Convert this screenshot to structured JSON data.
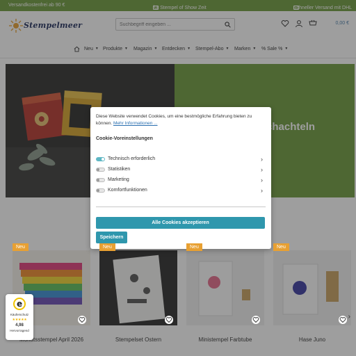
{
  "promo": {
    "left": "Versandkostenfrei ab 90 €",
    "center": "für Stempel of Show Zeit",
    "right": "Schneller Versand mit DHL"
  },
  "header": {
    "logo_text": "Stempelmeer",
    "search_placeholder": "Suchbegriff eingeben ...",
    "cart_value": "0,00 €",
    "icons": [
      "heart-icon",
      "user-icon",
      "cart-icon",
      "search-icon"
    ]
  },
  "nav": {
    "items": [
      {
        "label": "Neu"
      },
      {
        "label": "Produkte"
      },
      {
        "label": "Magazin"
      },
      {
        "label": "Entdecken"
      },
      {
        "label": "Stempel-Abo"
      },
      {
        "label": "Marken"
      },
      {
        "label": "% Sale %"
      }
    ]
  },
  "hero": {
    "title_fragment": "chachteln",
    "accent_color": "#6e9b3c"
  },
  "cookie": {
    "intro": "Diese Website verwendet Cookies, um eine bestmögliche Erfahrung bieten zu können.",
    "more_link": "Mehr Informationen ...",
    "settings_heading": "Cookie-Voreinstellungen",
    "options": [
      {
        "label": "Technisch erforderlich",
        "enabled": true
      },
      {
        "label": "Statistiken",
        "enabled": false
      },
      {
        "label": "Marketing",
        "enabled": false
      },
      {
        "label": "Komfortfunktionen",
        "enabled": false
      }
    ],
    "accept_label": "Alle Cookies akzeptieren",
    "save_label": "Speichern",
    "button_color": "#2f97ad"
  },
  "products": [
    {
      "name": "Monatsstempel April 2026",
      "badge": "Neu"
    },
    {
      "name": "Stempelset Ostern",
      "badge": "Neu"
    },
    {
      "name": "Ministempel Farbtube",
      "badge": "Neu"
    },
    {
      "name": "Hase Juno",
      "badge": "Neu"
    }
  ],
  "trust": {
    "label": "Käuferschutz",
    "stars": "★★★★★",
    "score": "4,98",
    "rating_text": "Hervorragend"
  }
}
